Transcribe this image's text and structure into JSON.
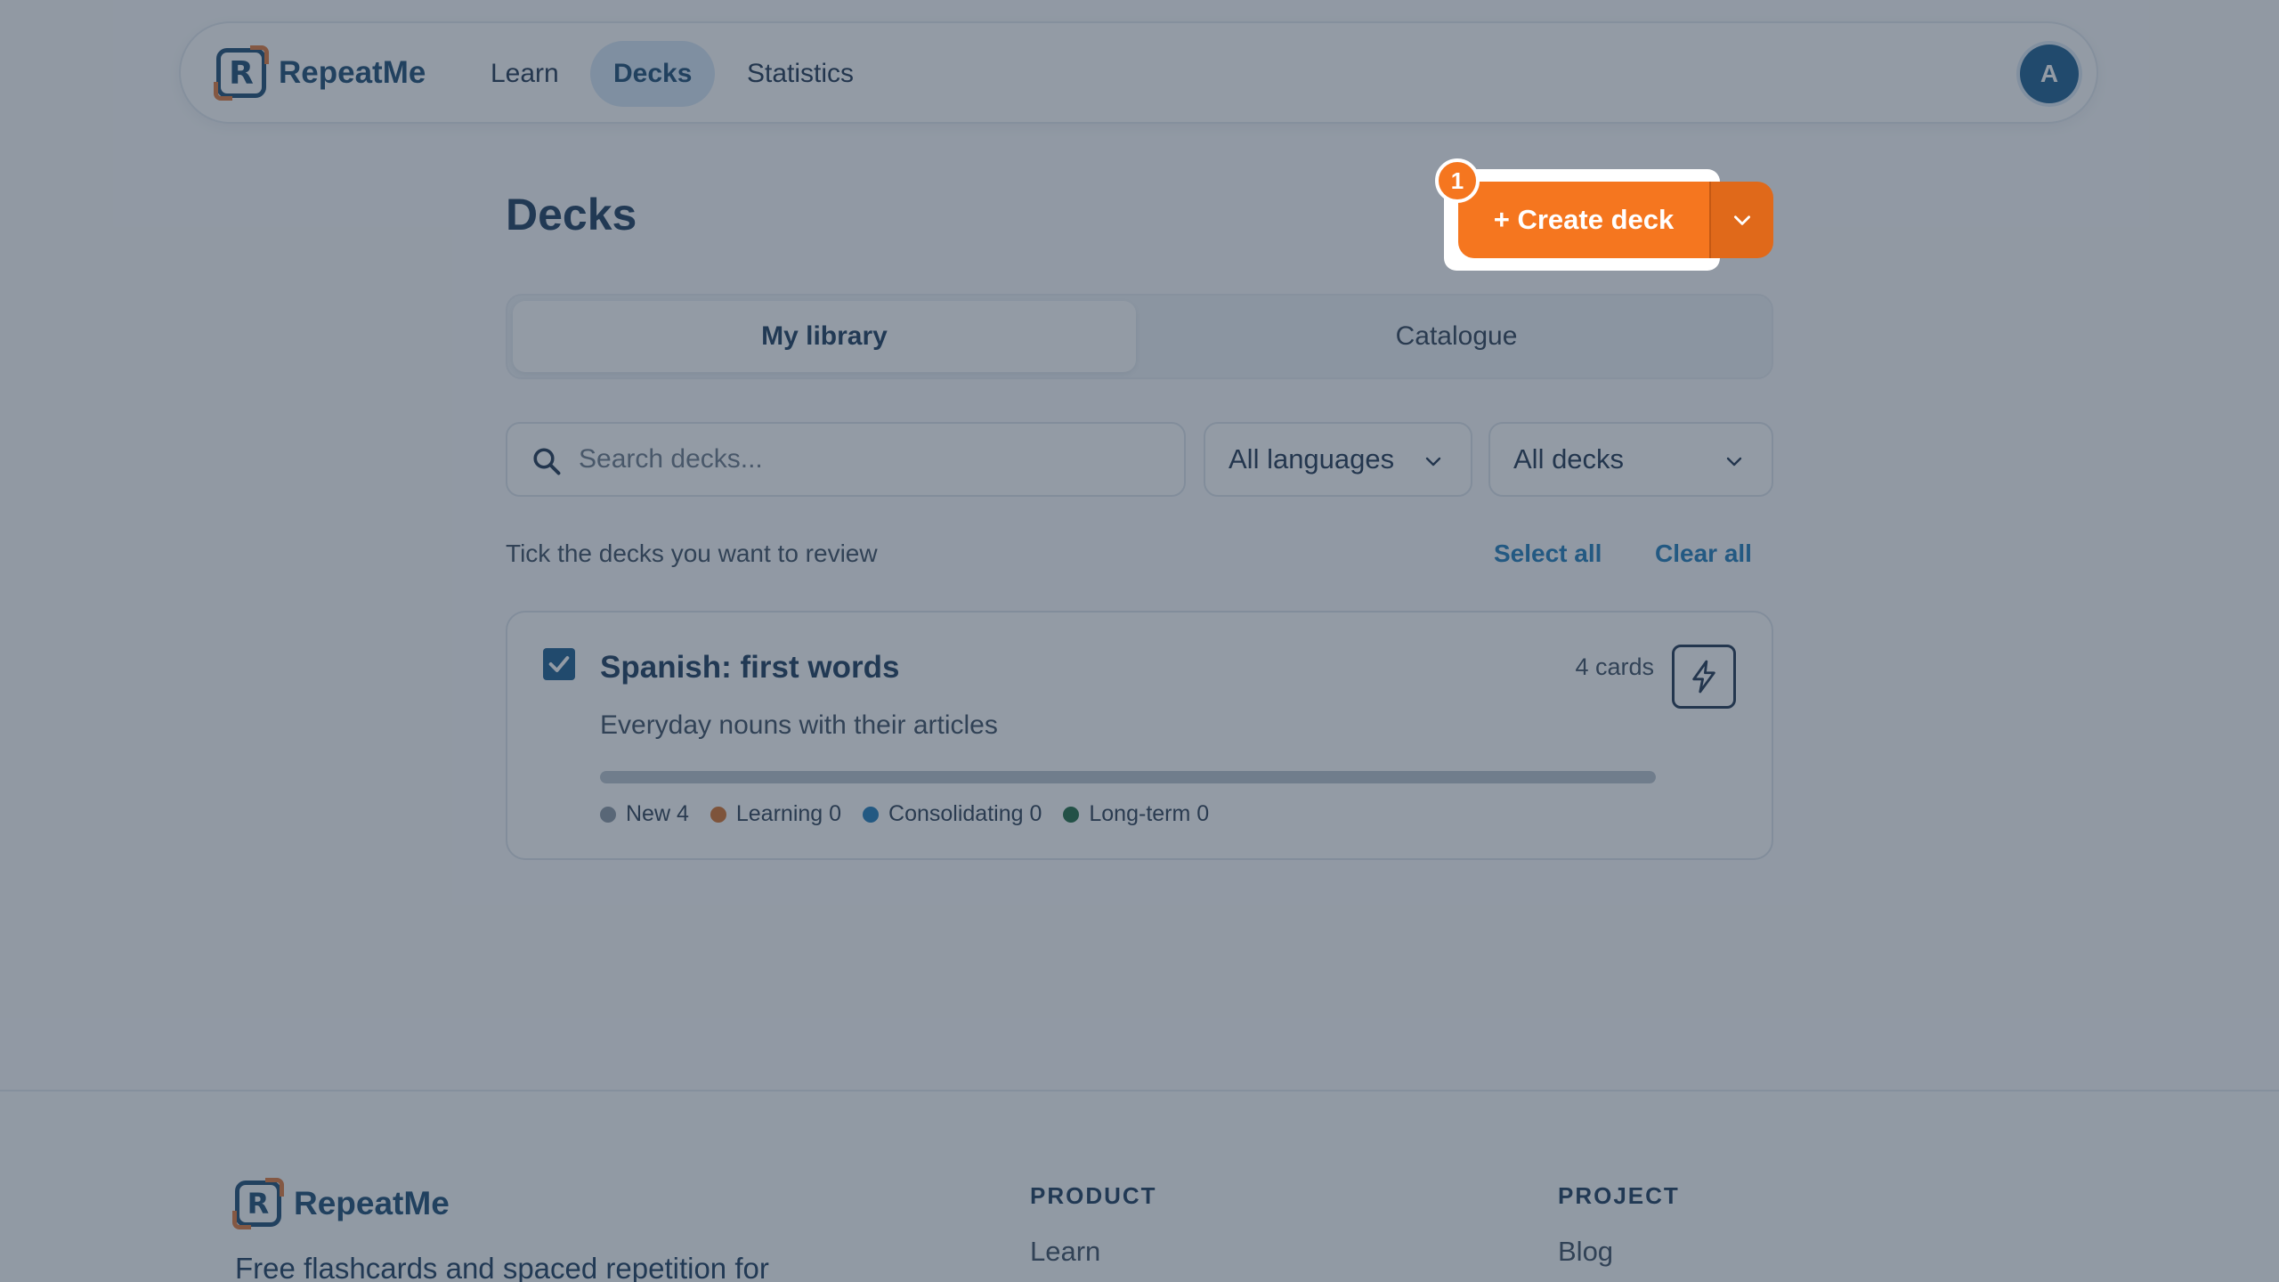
{
  "nav": {
    "brand": "RepeatMe",
    "links": [
      "Learn",
      "Decks",
      "Statistics"
    ],
    "avatar_initial": "A"
  },
  "header": {
    "title": "Decks",
    "create_label": "+ Create deck",
    "step_badge": "1"
  },
  "tabs": [
    "My library",
    "Catalogue"
  ],
  "filters": {
    "search_placeholder": "Search decks...",
    "language": "All languages",
    "deck_filter": "All decks"
  },
  "selection": {
    "hint": "Tick the decks you want to review",
    "select_all": "Select all",
    "clear_all": "Clear all"
  },
  "deck": {
    "title": "Spanish: first words",
    "description": "Everyday nouns with their articles",
    "count": "4 cards",
    "checked": true,
    "progress": 1.0,
    "legend": [
      {
        "label": "New 4",
        "color": "#8a96a3"
      },
      {
        "label": "Learning 0",
        "color": "#d4702a"
      },
      {
        "label": "Consolidating 0",
        "color": "#1f7ab8"
      },
      {
        "label": "Long-term 0",
        "color": "#1f6b42"
      }
    ]
  },
  "footer": {
    "brand": "RepeatMe",
    "tagline": "Free flashcards and spaced repetition for",
    "col1_heading": "PRODUCT",
    "col1_link": "Learn",
    "col2_heading": "PROJECT",
    "col2_link": "Blog"
  },
  "colors": {
    "accent": "#f5761f",
    "primary": "#1b5c8f"
  }
}
